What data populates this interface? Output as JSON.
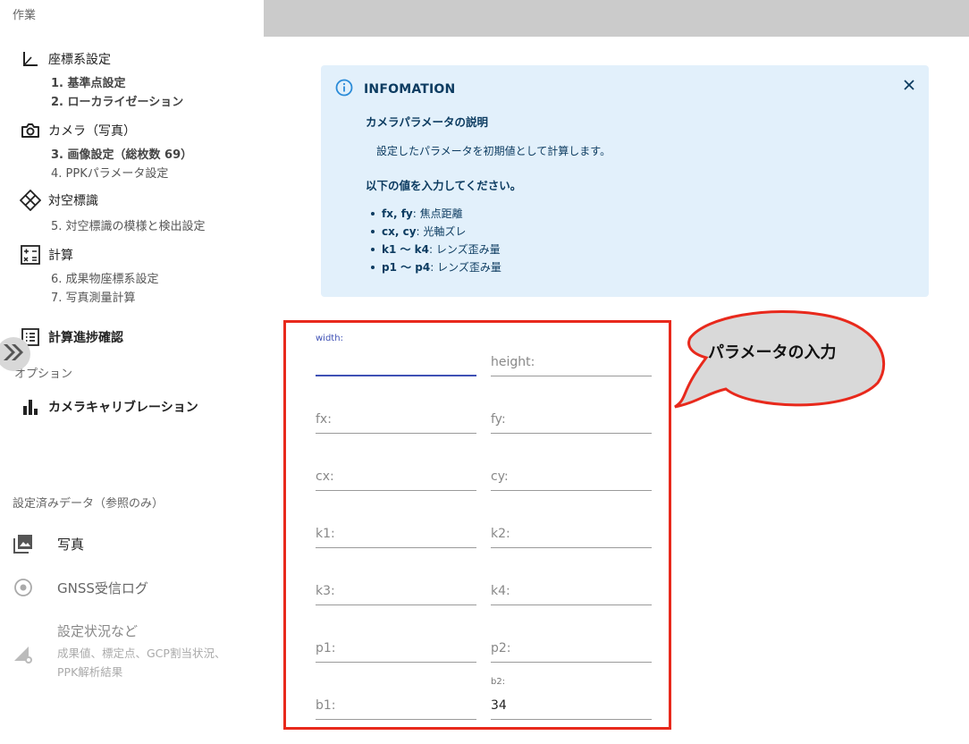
{
  "sidebar": {
    "section_work": "作業",
    "groups": [
      {
        "label": "座標系設定",
        "icon": "axis-icon"
      },
      {
        "label": "カメラ（写真）",
        "icon": "camera-icon"
      },
      {
        "label": "対空標識",
        "icon": "target-marker-icon"
      },
      {
        "label": "計算",
        "icon": "calculator-icon"
      },
      {
        "label": "計算進捗確認",
        "icon": "list-icon"
      }
    ],
    "subitems": [
      "1. 基準点設定",
      "2. ローカライゼーション",
      "3. 画像設定（総枚数 69）",
      "4. PPKパラメータ設定",
      "5. 対空標識の模様と検出設定",
      "6. 成果物座標系設定",
      "7. 写真測量計算"
    ],
    "section_option": "オプション",
    "option_item": "カメラキャリブレーション",
    "section_ref": "設定済みデータ（参照のみ）",
    "ref_items": [
      {
        "label": "写真",
        "icon": "photo-library-icon"
      },
      {
        "label": "GNSS受信ログ",
        "icon": "radio-button-icon"
      },
      {
        "label": "設定状況など",
        "icon": "signal-settings-icon"
      }
    ],
    "ref_desc_line1": "成果値、標定点、GCP割当状況、",
    "ref_desc_line2": "PPK解析結果",
    "collapse_icon": "double-chevron-right-icon"
  },
  "info": {
    "title": "INFOMATION",
    "subtitle": "カメラパラメータの説明",
    "description": "設定したパラメータを初期値として計算します。",
    "instruction": "以下の値を入力してください。",
    "items": [
      {
        "key": "fx, fy",
        "text": ": 焦点距離"
      },
      {
        "key": "cx, cy",
        "text": ": 光軸ズレ"
      },
      {
        "key": "k1 〜 k4",
        "text": ": レンズ歪み量"
      },
      {
        "key": "p1 〜 p4",
        "text": ": レンズ歪み量"
      }
    ]
  },
  "form": {
    "width_label": "width:",
    "height_label": "height:",
    "fx_label": "fx:",
    "fy_label": "fy:",
    "cx_label": "cx:",
    "cy_label": "cy:",
    "k1_label": "k1:",
    "k2_label": "k2:",
    "k3_label": "k3:",
    "k4_label": "k4:",
    "p1_label": "p1:",
    "p2_label": "p2:",
    "b1_label": "b1:",
    "b2_label": "b2:",
    "b2_value": "34"
  },
  "callout": {
    "text": "パラメータの入力"
  },
  "colors": {
    "accent": "#3f51b5",
    "info_bg": "#e2f0fb",
    "highlight": "#e8291c",
    "topbar": "#cbcbcb"
  }
}
